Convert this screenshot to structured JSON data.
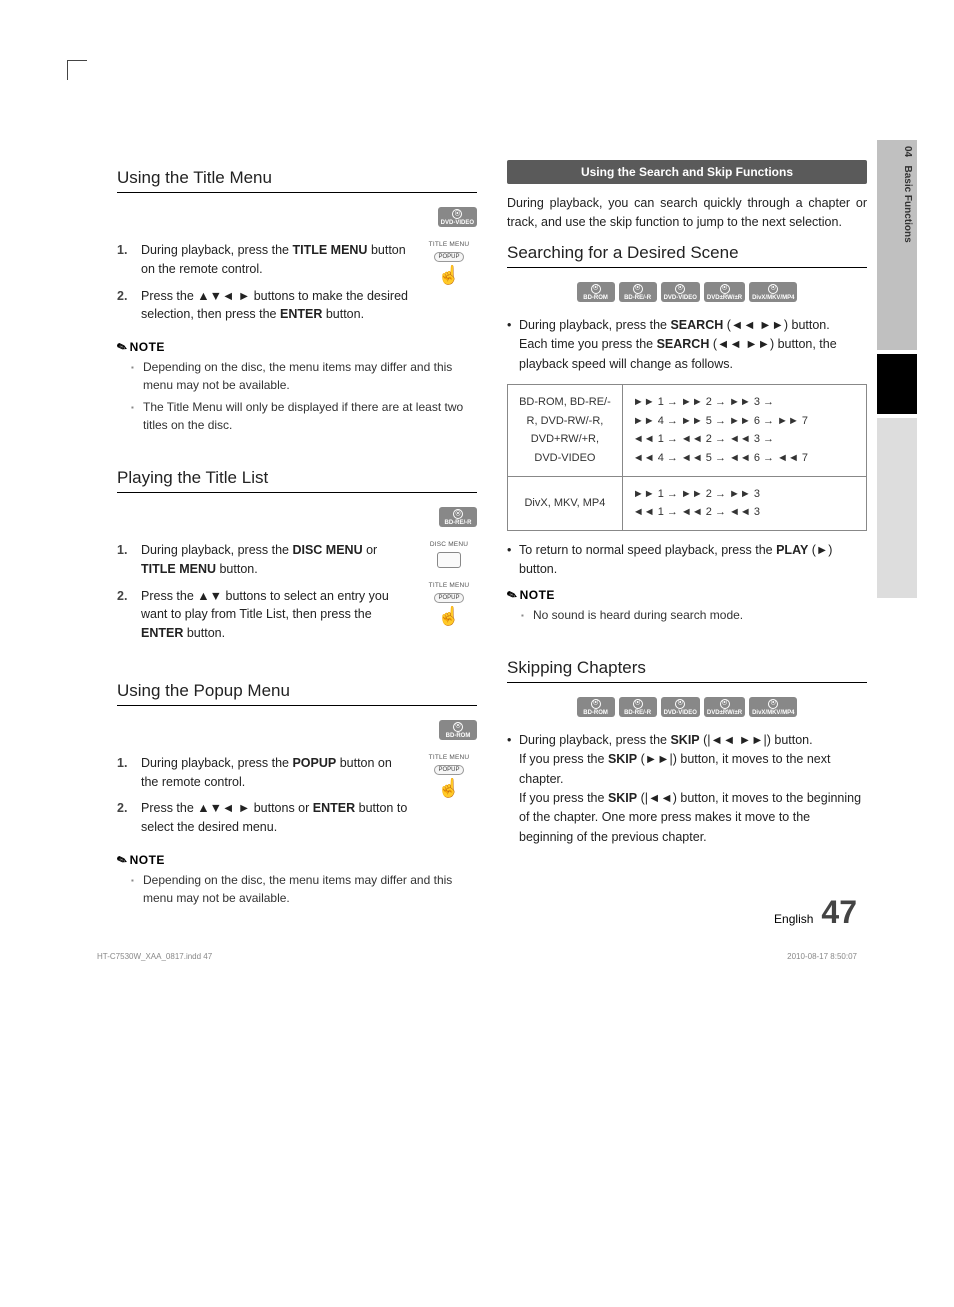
{
  "tab": {
    "chapter": "04",
    "title": "Basic Functions"
  },
  "left": {
    "sec1": {
      "heading": "Using the Title Menu",
      "badge": "DVD-VIDEO",
      "step1_a": "During playback, press the ",
      "step1_b": "TITLE MENU",
      "step1_c": " button on the remote control.",
      "step2_a": "Press the ▲▼◄ ► buttons to make the desired selection, then press the ",
      "step2_b": "ENTER",
      "step2_c": " button.",
      "graphic": {
        "l1": "TITLE MENU",
        "l2": "POPUP"
      },
      "note_head": "NOTE",
      "note1": "Depending on the disc, the menu items may differ and this menu may not be available.",
      "note2": "The Title Menu will only be displayed if there are at least two titles on the disc."
    },
    "sec2": {
      "heading": "Playing the Title List",
      "badge": "BD-RE/-R",
      "step1_a": "During playback, press the ",
      "step1_b": "DISC MENU",
      "step1_c": " or ",
      "step1_d": "TITLE MENU",
      "step1_e": " button.",
      "step2_a": "Press the ▲▼ buttons to select an entry you want to play from Title List, then press the ",
      "step2_b": "ENTER",
      "step2_c": " button.",
      "graphic": {
        "l1": "DISC MENU",
        "l2": "TITLE MENU",
        "l3": "POPUP"
      }
    },
    "sec3": {
      "heading": "Using the Popup Menu",
      "badge": "BD-ROM",
      "step1_a": "During playback, press the ",
      "step1_b": "POPUP",
      "step1_c": " button on the remote control.",
      "step2_a": "Press the ▲▼◄ ► buttons or ",
      "step2_b": "ENTER",
      "step2_c": " button to select the desired menu.",
      "graphic": {
        "l1": "TITLE MENU",
        "l2": "POPUP"
      },
      "note_head": "NOTE",
      "note1": "Depending on the disc, the menu items may differ and this menu may not be available."
    }
  },
  "right": {
    "bar": "Using the Search and Skip Functions",
    "intro": "During playback, you can search quickly through a chapter or track, and use the skip function to jump to the next selection.",
    "sec1": {
      "heading": "Searching for a Desired Scene",
      "badges": [
        "BD-ROM",
        "BD-RE/-R",
        "DVD-VIDEO",
        "DVD±RW/±R",
        "DivX/MKV/MP4"
      ],
      "b1_a": "During playback, press the ",
      "b1_b": "SEARCH",
      "b1_c": " (◄◄ ►►) button.",
      "b1_d": "Each time you press the ",
      "b1_e": "SEARCH",
      "b1_f": " (◄◄ ►►) button, the playback speed will change as follows.",
      "table": {
        "r1c1": "BD-ROM, BD-RE/-R, DVD-RW/-R, DVD+RW/+R, DVD-VIDEO",
        "r1c2": "►► 1 → ►► 2 → ►► 3 →\n►► 4 → ►► 5 → ►► 6 → ►► 7\n◄◄ 1 → ◄◄ 2 → ◄◄ 3 →\n◄◄ 4 → ◄◄ 5 → ◄◄ 6 → ◄◄ 7",
        "r2c1": "DivX, MKV, MP4",
        "r2c2": "►► 1 → ►► 2 → ►► 3\n◄◄ 1 → ◄◄ 2 → ◄◄ 3"
      },
      "b2_a": "To return to normal speed playback, press the ",
      "b2_b": "PLAY",
      "b2_c": " (►) button.",
      "note_head": "NOTE",
      "note1": "No sound is heard during search mode."
    },
    "sec2": {
      "heading": "Skipping Chapters",
      "badges": [
        "BD-ROM",
        "BD-RE/-R",
        "DVD-VIDEO",
        "DVD±RW/±R",
        "DivX/MKV/MP4"
      ],
      "b1_a": "During playback, press the ",
      "b1_b": "SKIP",
      "b1_c": " (|◄◄ ►►|) button.",
      "b1_d": "If you press the ",
      "b1_e": "SKIP",
      "b1_f": " (►►|) button, it moves to the next chapter.",
      "b1_g": "If you press the ",
      "b1_h": "SKIP",
      "b1_i": " (|◄◄) button, it moves to the beginning of the chapter. One more press makes it move to the beginning of the previous chapter."
    }
  },
  "footer": {
    "lang": "English",
    "page": "47"
  },
  "meta": {
    "file": "HT-C7530W_XAA_0817.indd   47",
    "date": "2010-08-17    8:50:07"
  }
}
